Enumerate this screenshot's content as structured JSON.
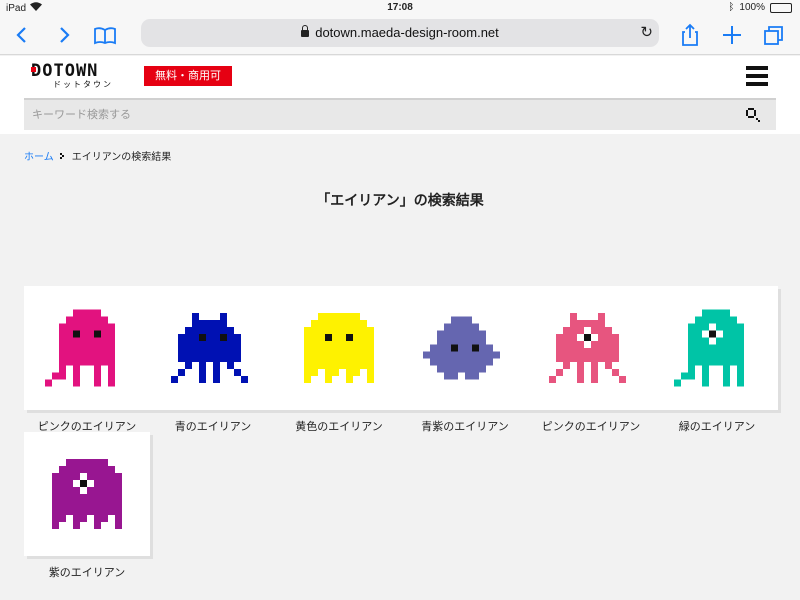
{
  "status_bar": {
    "device": "iPad",
    "time": "17:08",
    "battery": "100%",
    "battery_level": 1.0
  },
  "browser": {
    "url": "dotown.maeda-design-room.net"
  },
  "header": {
    "logo_text": "DOTOWN",
    "logo_kana": "ドットタウン",
    "badge": "無料・商用可"
  },
  "search": {
    "placeholder": "キーワード検索する"
  },
  "breadcrumb": {
    "home": "ホーム",
    "current": "エイリアンの検索結果"
  },
  "page_title": "「エイリアン」の検索結果",
  "results": [
    {
      "label": "ピンクのエイリアン",
      "color": "#e2127f",
      "type": "jellyfish",
      "eyes": "two"
    },
    {
      "label": "青のエイリアン",
      "color": "#0011b3",
      "type": "antenna",
      "eyes": "two"
    },
    {
      "label": "黄色のエイリアン",
      "color": "#fef200",
      "type": "ghost",
      "eyes": "two"
    },
    {
      "label": "青紫のエイリアン",
      "color": "#6566b0",
      "type": "blob",
      "eyes": "two"
    },
    {
      "label": "ピンクのエイリアン",
      "color": "#e7557f",
      "type": "antenna",
      "eyes": "one"
    },
    {
      "label": "緑のエイリアン",
      "color": "#00c4a6",
      "type": "jellyfish",
      "eyes": "one"
    },
    {
      "label": "紫のエイリアン",
      "color": "#981691",
      "type": "ghost",
      "eyes": "one"
    }
  ]
}
